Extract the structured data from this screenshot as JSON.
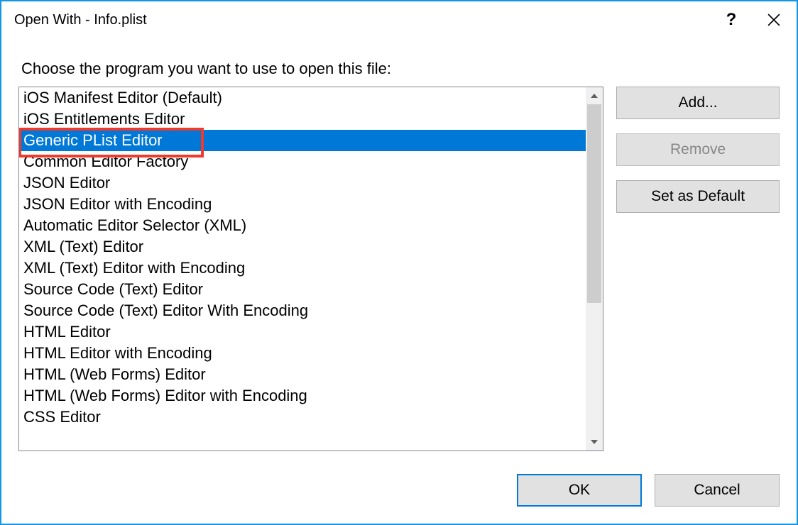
{
  "window": {
    "title": "Open With - Info.plist"
  },
  "prompt": "Choose the program you want to use to open this file:",
  "editors": [
    {
      "label": "iOS Manifest Editor (Default)",
      "selected": false
    },
    {
      "label": "iOS Entitlements Editor",
      "selected": false
    },
    {
      "label": "Generic PList Editor",
      "selected": true,
      "highlighted": true
    },
    {
      "label": "Common Editor Factory",
      "selected": false
    },
    {
      "label": "JSON Editor",
      "selected": false
    },
    {
      "label": "JSON Editor with Encoding",
      "selected": false
    },
    {
      "label": "Automatic Editor Selector (XML)",
      "selected": false
    },
    {
      "label": "XML (Text) Editor",
      "selected": false
    },
    {
      "label": "XML (Text) Editor with Encoding",
      "selected": false
    },
    {
      "label": "Source Code (Text) Editor",
      "selected": false
    },
    {
      "label": "Source Code (Text) Editor With Encoding",
      "selected": false
    },
    {
      "label": "HTML Editor",
      "selected": false
    },
    {
      "label": "HTML Editor with Encoding",
      "selected": false
    },
    {
      "label": "HTML (Web Forms) Editor",
      "selected": false
    },
    {
      "label": "HTML (Web Forms) Editor with Encoding",
      "selected": false
    },
    {
      "label": "CSS Editor",
      "selected": false
    }
  ],
  "buttons": {
    "add": "Add...",
    "remove": "Remove",
    "set_default": "Set as Default",
    "ok": "OK",
    "cancel": "Cancel"
  },
  "states": {
    "remove_disabled": true
  }
}
